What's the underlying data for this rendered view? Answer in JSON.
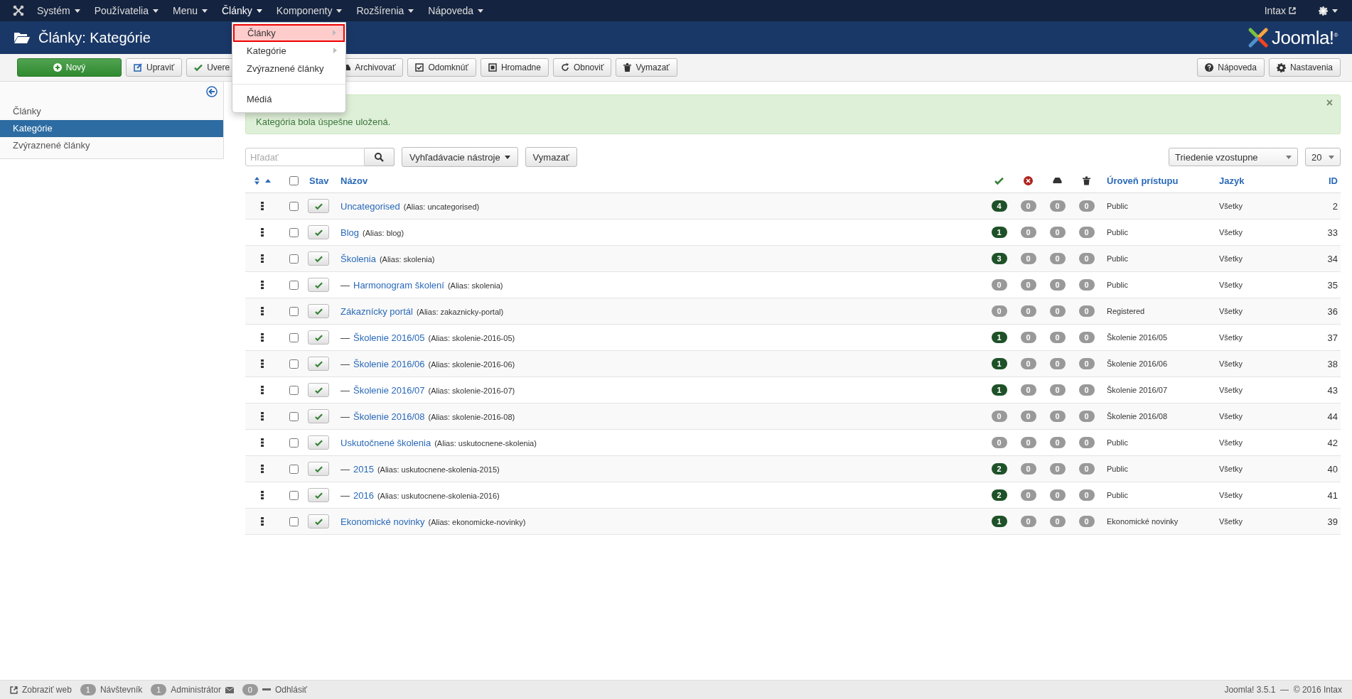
{
  "top_nav": {
    "items": [
      {
        "label": "Systém",
        "expanded": false
      },
      {
        "label": "Používatelia",
        "expanded": false
      },
      {
        "label": "Menu",
        "expanded": false
      },
      {
        "label": "Články",
        "expanded": true
      },
      {
        "label": "Komponenty",
        "expanded": false
      },
      {
        "label": "Rozšírenia",
        "expanded": false
      },
      {
        "label": "Nápoveda",
        "expanded": false
      }
    ],
    "user": "Intax"
  },
  "dropdown": {
    "items": [
      {
        "label": "Články",
        "highlighted": true,
        "submenu": true,
        "divider_before": false
      },
      {
        "label": "Kategórie",
        "highlighted": false,
        "submenu": true,
        "divider_before": false
      },
      {
        "label": "Zvýraznené články",
        "highlighted": false,
        "submenu": false,
        "divider_before": false
      },
      {
        "label": "Médiá",
        "highlighted": false,
        "submenu": false,
        "divider_before": true
      }
    ]
  },
  "header": {
    "title": "Články: Kategórie",
    "logo": "Joomla!$^{®}$"
  },
  "toolbar": {
    "buttons": [
      {
        "label": "Nový",
        "kind": "primary"
      },
      {
        "label": "Upraviť",
        "kind": "default"
      },
      {
        "label": "Uvere",
        "kind": "covered"
      },
      {
        "label": "Archivovať",
        "kind": "gap"
      },
      {
        "label": "Odomknúť",
        "kind": "default"
      },
      {
        "label": "Hromadne",
        "kind": "default"
      },
      {
        "label": "Obnoviť",
        "kind": "default"
      },
      {
        "label": "Vymazať",
        "kind": "default"
      }
    ],
    "right_buttons": [
      "Nápoveda",
      "Nastavenia"
    ]
  },
  "sidebar": {
    "items": [
      {
        "label": "Články",
        "selected": false
      },
      {
        "label": "Kategórie",
        "selected": true
      },
      {
        "label": "Zvýraznené články",
        "selected": false
      }
    ]
  },
  "alert": {
    "message": "Kategória bola úspešne uložená.",
    "close": "×"
  },
  "filters": {
    "search": {
      "placeholder": "Hľadať"
    },
    "tools": "Vyhľadávacie nástroje",
    "clear": "Vymazať",
    "ordering": "Triedenie vzostupne",
    "limit": "20"
  },
  "table": {
    "select_all_checked": false,
    "columns": {
      "status": "Stav",
      "title": "Názov",
      "access": "Úroveň prístupu",
      "language": "Jazyk",
      "id": "ID"
    },
    "rows": [
      {
        "title": "Uncategorised",
        "alias": "(Alias: uncategorised)",
        "published": true,
        "checked": false,
        "counts": [
          "4",
          "0",
          "0",
          "0"
        ],
        "has_published_items": true,
        "access": "Public",
        "language": "Všetky",
        "id": "2"
      },
      {
        "title": "Blog",
        "alias": "(Alias: blog)",
        "published": true,
        "checked": false,
        "counts": [
          "1",
          "0",
          "0",
          "0"
        ],
        "has_published_items": true,
        "access": "Public",
        "language": "Všetky",
        "id": "33"
      },
      {
        "title": "Školenia",
        "alias": "(Alias: skolenia)",
        "published": true,
        "checked": false,
        "counts": [
          "3",
          "0",
          "0",
          "0"
        ],
        "has_published_items": true,
        "access": "Public",
        "language": "Všetky",
        "id": "34",
        "children": [
          {
            "indent_mark": "—",
            "title": "Harmonogram školení",
            "alias": "(Alias: skolenia)",
            "published": true,
            "checked": false,
            "counts": [
              "0",
              "0",
              "0",
              "0"
            ],
            "has_published_items": false,
            "access": "Public",
            "language": "Všetky",
            "id": "35"
          }
        ]
      },
      {
        "title": "Zákaznícky portál",
        "alias": "(Alias: zakaznicky-portal)",
        "published": true,
        "checked": false,
        "counts": [
          "0",
          "0",
          "0",
          "0"
        ],
        "has_published_items": false,
        "access": "Registered",
        "language": "Všetky",
        "id": "36",
        "children": [
          {
            "indent_mark": "—",
            "title": "Školenie 2016/05",
            "alias": "(Alias: skolenie-2016-05)",
            "published": true,
            "checked": false,
            "counts": [
              "1",
              "0",
              "0",
              "0"
            ],
            "has_published_items": true,
            "access": "Školenie 2016/05",
            "language": "Všetky",
            "id": "37"
          },
          {
            "indent_mark": "—",
            "title": "Školenie 2016/06",
            "alias": "(Alias: skolenie-2016-06)",
            "published": true,
            "checked": false,
            "counts": [
              "1",
              "0",
              "0",
              "0"
            ],
            "has_published_items": true,
            "access": "Školenie 2016/06",
            "language": "Všetky",
            "id": "38"
          },
          {
            "indent_mark": "—",
            "title": "Školenie 2016/07",
            "alias": "(Alias: skolenie-2016-07)",
            "published": true,
            "checked": false,
            "counts": [
              "1",
              "0",
              "0",
              "0"
            ],
            "has_published_items": true,
            "access": "Školenie 2016/07",
            "language": "Všetky",
            "id": "43"
          },
          {
            "indent_mark": "—",
            "title": "Školenie 2016/08",
            "alias": "(Alias: skolenie-2016-08)",
            "published": true,
            "checked": false,
            "counts": [
              "0",
              "0",
              "0",
              "0"
            ],
            "has_published_items": false,
            "access": "Školenie 2016/08",
            "language": "Všetky",
            "id": "44"
          }
        ]
      },
      {
        "title": "Uskutočnené školenia",
        "alias": "(Alias: uskutocnene-skolenia)",
        "published": true,
        "checked": false,
        "counts": [
          "0",
          "0",
          "0",
          "0"
        ],
        "has_published_items": false,
        "access": "Public",
        "language": "Všetky",
        "id": "42",
        "children": [
          {
            "indent_mark": "—",
            "title": "2015",
            "alias": "(Alias: uskutocnene-skolenia-2015)",
            "published": true,
            "checked": false,
            "counts": [
              "2",
              "0",
              "0",
              "0"
            ],
            "has_published_items": true,
            "access": "Public",
            "language": "Všetky",
            "id": "40"
          },
          {
            "indent_mark": "—",
            "title": "2016",
            "alias": "(Alias: uskutocnene-skolenia-2016)",
            "published": true,
            "checked": false,
            "counts": [
              "2",
              "0",
              "0",
              "0"
            ],
            "has_published_items": true,
            "access": "Public",
            "language": "Všetky",
            "id": "41"
          }
        ]
      },
      {
        "title": "Ekonomické novinky",
        "alias": "(Alias: ekonomicke-novinky)",
        "published": true,
        "checked": false,
        "counts": [
          "1",
          "0",
          "0",
          "0"
        ],
        "has_published_items": true,
        "access": "Ekonomické novinky",
        "language": "Všetky",
        "id": "39"
      }
    ]
  },
  "status_bar": {
    "view_site": "Zobraziť web",
    "visitors": {
      "count": "1",
      "label": "Návštevník"
    },
    "admins": {
      "count": "1",
      "label": "Administrátor"
    },
    "messages": "0",
    "logout": "Odhlásiť",
    "version": "Joomla! 3.5.1  —  © 2016 Intax"
  }
}
